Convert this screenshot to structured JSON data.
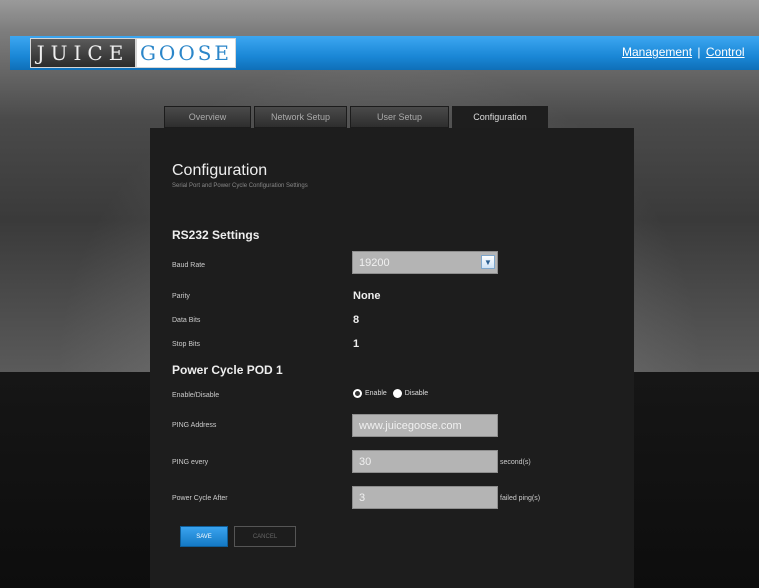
{
  "brand": {
    "logo_part1": "JUICE",
    "logo_part2": "GOOSE"
  },
  "topnav": {
    "management": "Management",
    "separator": "|",
    "control": "Control"
  },
  "tabs": [
    {
      "label": "Overview"
    },
    {
      "label": "Network Setup"
    },
    {
      "label": "User Setup"
    },
    {
      "label": "Configuration"
    }
  ],
  "page": {
    "title": "Configuration",
    "subtitle": "Serial Port and Power Cycle Configuration Settings"
  },
  "rs232": {
    "heading": "RS232 Settings",
    "baud_label": "Baud Rate",
    "baud_value": "19200",
    "parity_label": "Parity",
    "parity_value": "None",
    "databits_label": "Data Bits",
    "databits_value": "8",
    "stopbits_label": "Stop Bits",
    "stopbits_value": "1"
  },
  "pod": {
    "heading": "Power Cycle POD 1",
    "enable_label": "Enable/Disable",
    "enable_option": "Enable",
    "disable_option": "Disable",
    "ping_address_label": "PING Address",
    "ping_address_value": "www.juicegoose.com",
    "ping_every_label": "PING every",
    "ping_every_value": "30",
    "ping_every_suffix": "second(s)",
    "power_cycle_label": "Power Cycle After",
    "power_cycle_value": "3",
    "power_cycle_suffix": "failed ping(s)"
  },
  "buttons": {
    "save": "SAVE",
    "cancel": "CANCEL"
  },
  "colors": {
    "accent": "#1a87d6",
    "panel": "#1d1d1d",
    "field": "#b4b4b4"
  },
  "icons": {
    "select_arrow": "chevron-down-icon"
  }
}
